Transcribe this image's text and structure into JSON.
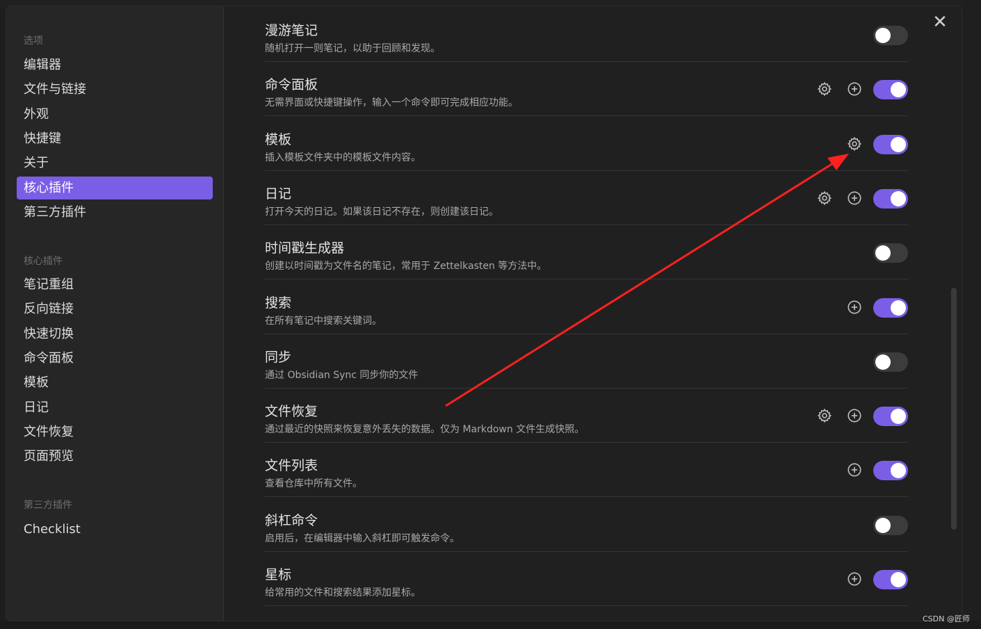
{
  "sidebar": {
    "heading_options": "选项",
    "options": [
      {
        "label": "编辑器"
      },
      {
        "label": "文件与链接"
      },
      {
        "label": "外观"
      },
      {
        "label": "快捷键"
      },
      {
        "label": "关于"
      },
      {
        "label": "核心插件",
        "active": true
      },
      {
        "label": "第三方插件"
      }
    ],
    "heading_core": "核心插件",
    "core": [
      {
        "label": "笔记重组"
      },
      {
        "label": "反向链接"
      },
      {
        "label": "快速切换"
      },
      {
        "label": "命令面板"
      },
      {
        "label": "模板"
      },
      {
        "label": "日记"
      },
      {
        "label": "文件恢复"
      },
      {
        "label": "页面预览"
      }
    ],
    "heading_third": "第三方插件",
    "third": [
      {
        "label": "Checklist"
      }
    ]
  },
  "plugins": [
    {
      "title": "漫游笔记",
      "desc": "随机打开一则笔记，以助于回顾和发现。",
      "gear": false,
      "plus": false,
      "on": false
    },
    {
      "title": "命令面板",
      "desc": "无需界面或快捷键操作，输入一个命令即可完成相应功能。",
      "gear": true,
      "plus": true,
      "on": true
    },
    {
      "title": "模板",
      "desc": "插入模板文件夹中的模板文件内容。",
      "gear": true,
      "plus": false,
      "on": true
    },
    {
      "title": "日记",
      "desc": "打开今天的日记。如果该日记不存在，则创建该日记。",
      "gear": true,
      "plus": true,
      "on": true
    },
    {
      "title": "时间戳生成器",
      "desc": "创建以时间戳为文件名的笔记，常用于 Zettelkasten 等方法中。",
      "gear": false,
      "plus": false,
      "on": false
    },
    {
      "title": "搜索",
      "desc": "在所有笔记中搜索关键词。",
      "gear": false,
      "plus": true,
      "on": true
    },
    {
      "title": "同步",
      "desc": "通过 Obsidian Sync 同步你的文件",
      "gear": false,
      "plus": false,
      "on": false
    },
    {
      "title": "文件恢复",
      "desc": "通过最近的快照来恢复意外丢失的数据。仅为 Markdown 文件生成快照。",
      "gear": true,
      "plus": true,
      "on": true
    },
    {
      "title": "文件列表",
      "desc": "查看仓库中所有文件。",
      "gear": false,
      "plus": true,
      "on": true
    },
    {
      "title": "斜杠命令",
      "desc": "启用后，在编辑器中输入斜杠即可触发命令。",
      "gear": false,
      "plus": false,
      "on": false
    },
    {
      "title": "星标",
      "desc": "给常用的文件和搜索结果添加星标。",
      "gear": false,
      "plus": true,
      "on": true
    }
  ],
  "icons": {
    "close": "close-icon",
    "gear": "gear-icon",
    "plus": "plus-circle-icon"
  },
  "colors": {
    "accent": "#7b5ee6",
    "annotation_arrow": "#ff2020"
  },
  "watermark": "CSDN @匠师"
}
